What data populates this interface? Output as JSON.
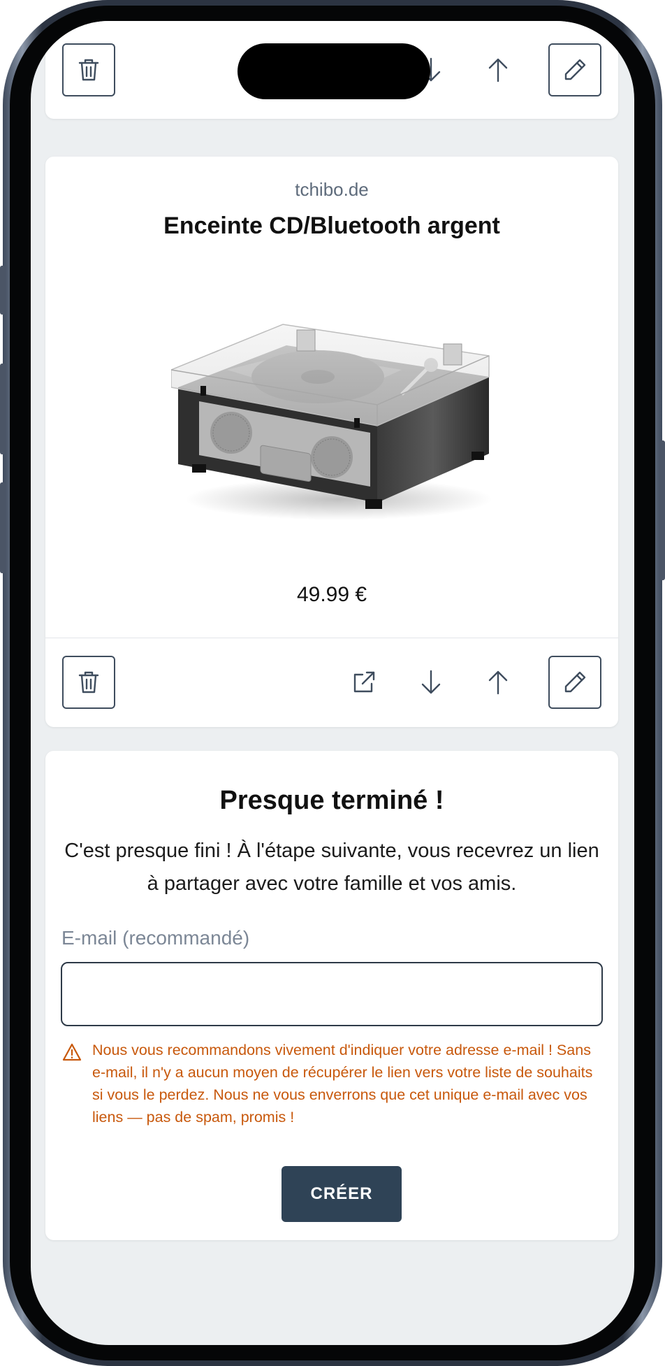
{
  "product": {
    "source": "tchibo.de",
    "title": "Enceinte CD/Bluetooth argent",
    "price": "49.99 €",
    "image_alt": "CD/Bluetooth speaker with clear lid"
  },
  "icons": {
    "delete": "trash-icon",
    "open_link": "external-link-icon",
    "move_down": "arrow-down-icon",
    "move_up": "arrow-up-icon",
    "edit": "pencil-icon",
    "warning": "warning-triangle-icon"
  },
  "form": {
    "title": "Presque terminé !",
    "description": "C'est presque fini ! À l'étape suivante, vous recevrez un lien à partager avec votre famille et vos amis.",
    "email_label": "E-mail (recommandé)",
    "email_value": "",
    "warning": "Nous vous recommandons vivement d'indiquer votre adresse e-mail ! Sans e-mail, il n'y a aucun moyen de récupérer le lien vers votre liste de souhaits si vous le perdez. Nous ne vous enverrons que cet unique e-mail avec vos liens — pas de spam, promis !",
    "submit_label": "CRÉER"
  },
  "colors": {
    "primary_button": "#2f4356",
    "warning": "#c8590d",
    "page_background": "#eceff1"
  }
}
